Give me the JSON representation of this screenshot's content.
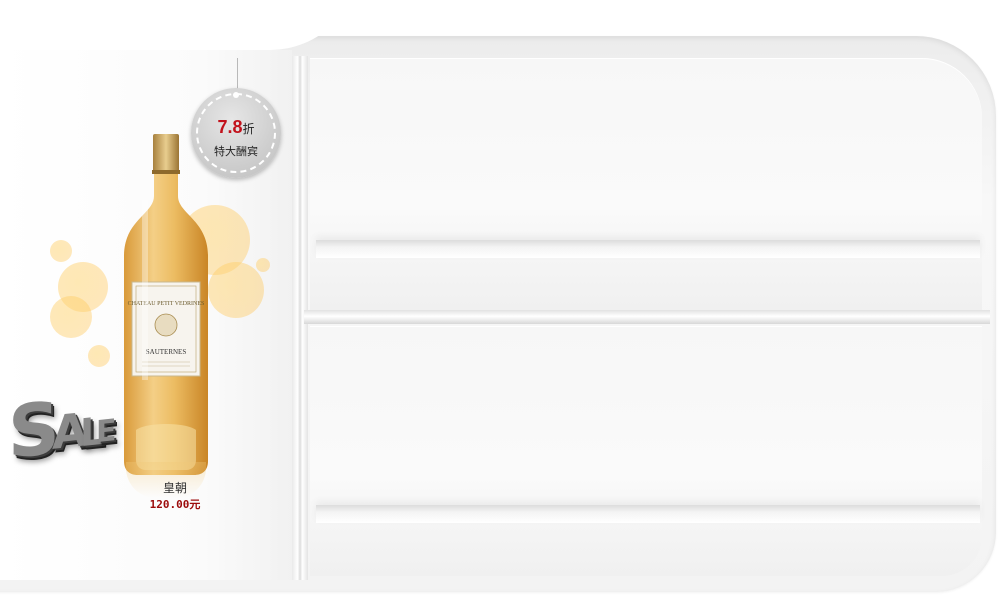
{
  "promo": {
    "discount_value": "7.8",
    "discount_unit": "折",
    "tagline": "特大酬宾",
    "sale_badge": [
      "S",
      "A",
      "L",
      "E"
    ],
    "bottle_label_title": "CHATEAU PETIT VEDRINES",
    "bottle_label_region": "SAUTERNES"
  },
  "product": {
    "name": "皇朝",
    "price": "120.00元"
  },
  "colors": {
    "price": "#9c0b0b",
    "discount": "#c2121c",
    "wine": "#e8b761",
    "bubble": "#ffcf6b"
  }
}
